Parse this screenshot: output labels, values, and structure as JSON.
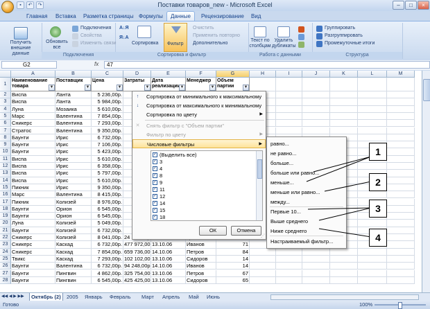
{
  "window": {
    "title": "Поставки товаров_new - Microsoft Excel"
  },
  "tabs": [
    "Главная",
    "Вставка",
    "Разметка страницы",
    "Формулы",
    "Данные",
    "Рецензирование",
    "Вид"
  ],
  "ribbon": {
    "get_external": "Получить внешние данные",
    "refresh_all": "Обновить все",
    "connections": "Подключения",
    "properties": "Свойства",
    "edit_links": "Изменить связи",
    "connections_group": "Подключения",
    "sort": "Сортировка",
    "filter": "Фильтр",
    "clear": "Очистить",
    "reapply": "Применить повторно",
    "advanced": "Дополнительно",
    "sort_filter_group": "Сортировка и фильтр",
    "text_to_cols": "Текст по столбцам",
    "remove_dup": "Удалить дубликаты",
    "data_tools_group": "Работа с данными",
    "group": "Группировать",
    "ungroup": "Разгруппировать",
    "subtotal": "Промежуточные итоги",
    "outline_group": "Структура"
  },
  "formula_bar": {
    "name": "G2",
    "fx": "fx",
    "value": "47"
  },
  "columns": [
    "A",
    "B",
    "C",
    "D",
    "E",
    "F",
    "G",
    "H",
    "I",
    "J",
    "K",
    "L",
    "M"
  ],
  "headers": [
    "Наименование товара",
    "Поставщик",
    "Цена",
    "Затраты",
    "Дата реализации",
    "Менеджер",
    "Объем партии"
  ],
  "rows": [
    [
      "Виспа",
      "Ланта",
      "5 236,00р.",
      "",
      "",
      "",
      ""
    ],
    [
      "Виспа",
      "Ланта",
      "5 984,00р.",
      "",
      "",
      "",
      ""
    ],
    [
      "Луна",
      "Мозаика",
      "5 610,00р.",
      "",
      "",
      "",
      ""
    ],
    [
      "Марс",
      "Валентина",
      "7 854,00р.",
      "",
      "",
      "",
      ""
    ],
    [
      "Сникерс",
      "Валентина",
      "7 293,00р.",
      "",
      "",
      "",
      ""
    ],
    [
      "Стратос",
      "Валентина",
      "9 350,00р.",
      "",
      "",
      "",
      ""
    ],
    [
      "Баунти",
      "Ирис",
      "6 732,00р.",
      "",
      "",
      "",
      ""
    ],
    [
      "Баунти",
      "Ирис",
      "7 106,00р.",
      "",
      "",
      "",
      ""
    ],
    [
      "Баунти",
      "Ирис",
      "5 423,00р.",
      "",
      "",
      "",
      ""
    ],
    [
      "Виспа",
      "Ирис",
      "5 610,00р.",
      "",
      "",
      "",
      ""
    ],
    [
      "Виспа",
      "Ирис",
      "6 358,00р.",
      "",
      "",
      "",
      ""
    ],
    [
      "Виспа",
      "Ирис",
      "5 797,00р.",
      "",
      "",
      "",
      ""
    ],
    [
      "Виспа",
      "Ирис",
      "5 610,00р.",
      "",
      "",
      "",
      ""
    ],
    [
      "Пикник",
      "Ирис",
      "9 350,00р.",
      "",
      "",
      "",
      ""
    ],
    [
      "Марс",
      "Валентина",
      "8 415,00р.",
      "",
      "",
      "",
      ""
    ],
    [
      "Пикник",
      "Колизей",
      "8 976,00р.",
      "",
      "",
      "",
      ""
    ],
    [
      "Баунти",
      "Орион",
      "6 545,00р.",
      "",
      "",
      "",
      ""
    ],
    [
      "Баунти",
      "Орион",
      "6 545,00р.",
      "",
      "",
      "",
      ""
    ],
    [
      "Луна",
      "Колизей",
      "5 049,00р.",
      "",
      "",
      "",
      ""
    ],
    [
      "Баунти",
      "Колизей",
      "6 732,00р.",
      "",
      "",
      "",
      ""
    ],
    [
      "Сникерс",
      "Колизей",
      "8 041,00р.",
      "24 123,00р.",
      "13.10.06",
      "Гришин",
      "3"
    ],
    [
      "Сникерс",
      "Каскад",
      "6 732,00р.",
      "477 972,00р.",
      "13.10.06",
      "Иванов",
      "71"
    ],
    [
      "Сникерс",
      "Каскад",
      "7 854,00р.",
      "659 736,00р.",
      "14.10.06",
      "Петров",
      "84"
    ],
    [
      "Твикс",
      "Каскад",
      "7 293,00р.",
      "102 102,00р.",
      "13.10.06",
      "Сидоров",
      "14"
    ],
    [
      "Баунти",
      "Валентина",
      "6 732,00р.",
      "94 248,00р.",
      "14.10.06",
      "Иванов",
      "14"
    ],
    [
      "Баунти",
      "Пингвин",
      "4 862,00р.",
      "325 754,00р.",
      "13.10.06",
      "Петров",
      "67"
    ],
    [
      "Баунти",
      "Пингвин",
      "6 545,00р.",
      "425 425,00р.",
      "13.10.06",
      "Сидоров",
      "65"
    ]
  ],
  "menu1": {
    "sort_asc": "Сортировка от минимального к максимальному",
    "sort_desc": "Сортировка от максимального к минимальному",
    "sort_color": "Сортировка по цвету",
    "clear_filter": "Снять фильтр с \"Объем партии\"",
    "filter_color": "Фильтр по цвету",
    "num_filters": "Числовые фильтры",
    "select_all": "(Выделить все)",
    "values": [
      "3",
      "4",
      "8",
      "9",
      "11",
      "12",
      "14",
      "15",
      "18"
    ],
    "ok": "ОК",
    "cancel": "Отмена"
  },
  "submenu": [
    "равно...",
    "не равно...",
    "больше...",
    "больше или равно...",
    "меньше...",
    "меньше или равно...",
    "между...",
    "Первые 10...",
    "Выше среднего",
    "Ниже среднего",
    "Настраиваемый фильтр..."
  ],
  "callouts": [
    "1",
    "2",
    "3",
    "4"
  ],
  "sheets": [
    "Октябрь (2)",
    "2005",
    "Январь",
    "Февраль",
    "Март",
    "Апрель",
    "Май",
    "Июнь"
  ],
  "status": {
    "ready": "Готово",
    "zoom": "100%"
  }
}
